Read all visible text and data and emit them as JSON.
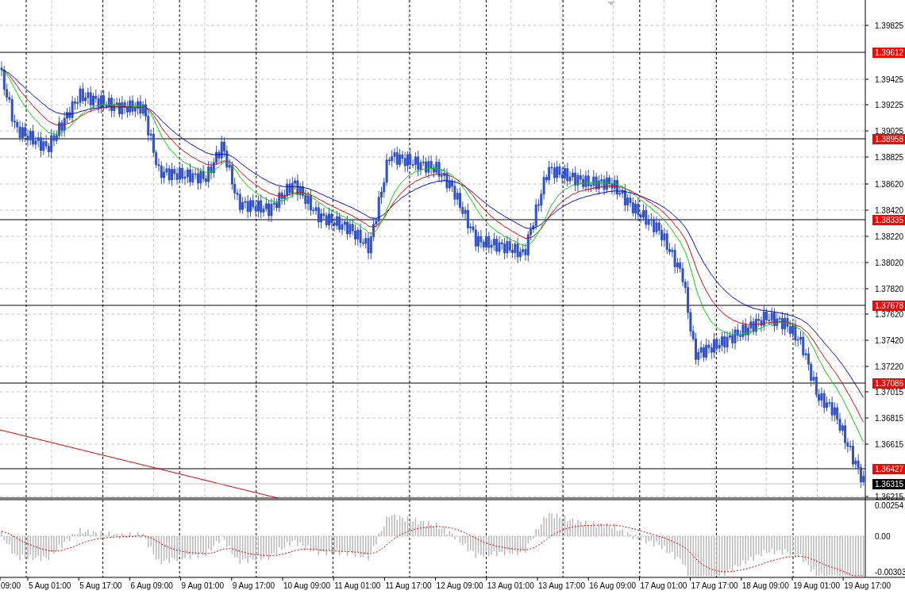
{
  "price_axis": {
    "ticks": [
      "1.39825",
      "1.39425",
      "1.39225",
      "1.39025",
      "1.38825",
      "1.38620",
      "1.38420",
      "1.38220",
      "1.38020",
      "1.37820",
      "1.37620",
      "1.37420",
      "1.37220",
      "1.37015",
      "1.36815",
      "1.36615",
      "1.36215"
    ]
  },
  "level_lines": [
    {
      "label": "1.39612"
    },
    {
      "label": "1.38958"
    },
    {
      "label": "1.38335"
    },
    {
      "label": "1.37678"
    },
    {
      "label": "1.37086"
    },
    {
      "label": "1.36427"
    }
  ],
  "current_price": {
    "label": "1.36315"
  },
  "indicator_axis": {
    "ticks": [
      "0.00254",
      "0.00",
      "-0.00303"
    ]
  },
  "time_axis": {
    "labels": [
      "09:00",
      "5 Aug 01:00",
      "5 Aug 17:00",
      "6 Aug 09:00",
      "9 Aug 01:00",
      "9 Aug 17:00",
      "10 Aug 09:00",
      "11 Aug 01:00",
      "11 Aug 17:00",
      "12 Aug 09:00",
      "13 Aug 01:00",
      "13 Aug 17:00",
      "16 Aug 09:00",
      "17 Aug 01:00",
      "17 Aug 17:00",
      "18 Aug 09:00",
      "19 Aug 01:00",
      "19 Aug 17:00"
    ]
  }
}
